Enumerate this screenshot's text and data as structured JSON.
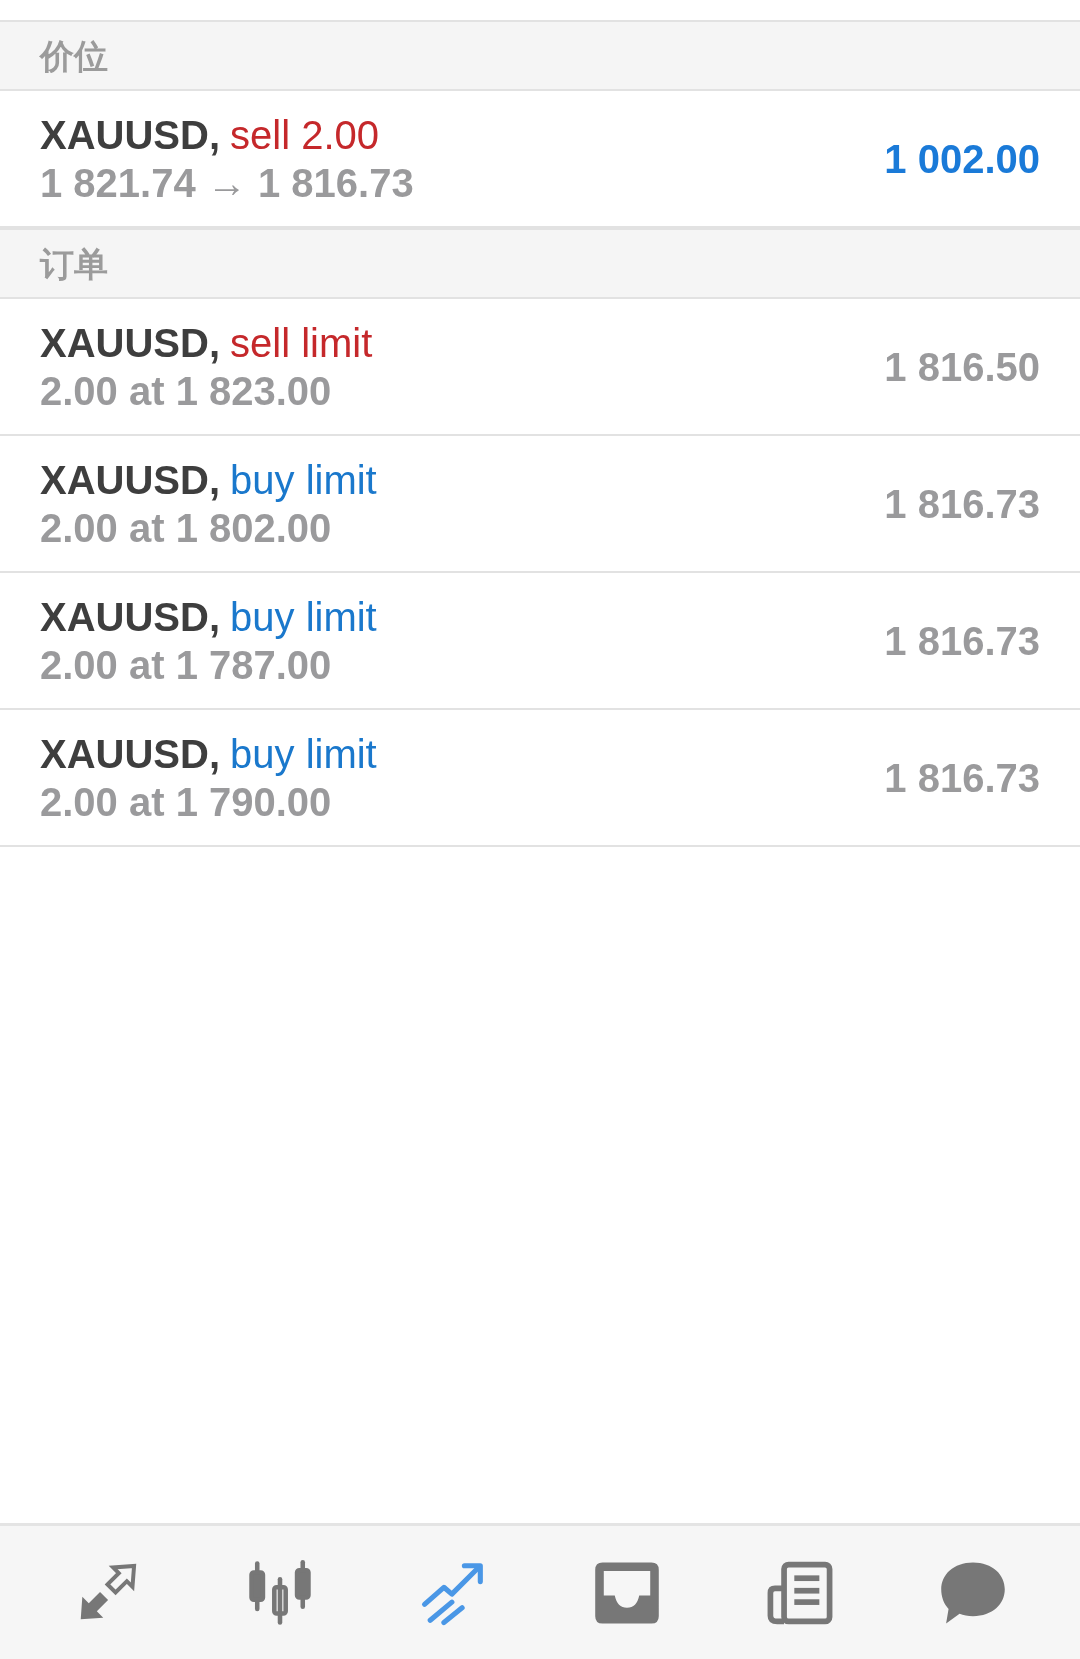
{
  "sections": [
    {
      "title": "价位",
      "rows": [
        {
          "kind": "position",
          "symbol": "XAUUSD,",
          "type": "sell 2.00",
          "color": "#c5282b",
          "detail": "1 821.74 → 1 816.73",
          "value": "1 002.00"
        }
      ]
    },
    {
      "title": "订单",
      "rows": [
        {
          "kind": "order",
          "symbol": "XAUUSD,",
          "type": "sell limit",
          "color": "#c5282b",
          "detail": "2.00 at 1 823.00",
          "value": "1 816.50"
        },
        {
          "kind": "order",
          "symbol": "XAUUSD,",
          "type": "buy limit",
          "color": "#1a78cc",
          "detail": "2.00 at 1 802.00",
          "value": "1 816.73"
        },
        {
          "kind": "order",
          "symbol": "XAUUSD,",
          "type": "buy limit",
          "color": "#1a78cc",
          "detail": "2.00 at 1 787.00",
          "value": "1 816.73"
        },
        {
          "kind": "order",
          "symbol": "XAUUSD,",
          "type": "buy limit",
          "color": "#1a78cc",
          "detail": "2.00 at 1 790.00",
          "value": "1 816.73"
        }
      ]
    }
  ],
  "nav": {
    "tabs": [
      {
        "kind": "arrows",
        "selected": false
      },
      {
        "kind": "candles",
        "selected": false
      },
      {
        "kind": "trend",
        "selected": true
      },
      {
        "kind": "inbox",
        "selected": false
      },
      {
        "kind": "news",
        "selected": false
      },
      {
        "kind": "chat",
        "selected": false
      }
    ]
  }
}
